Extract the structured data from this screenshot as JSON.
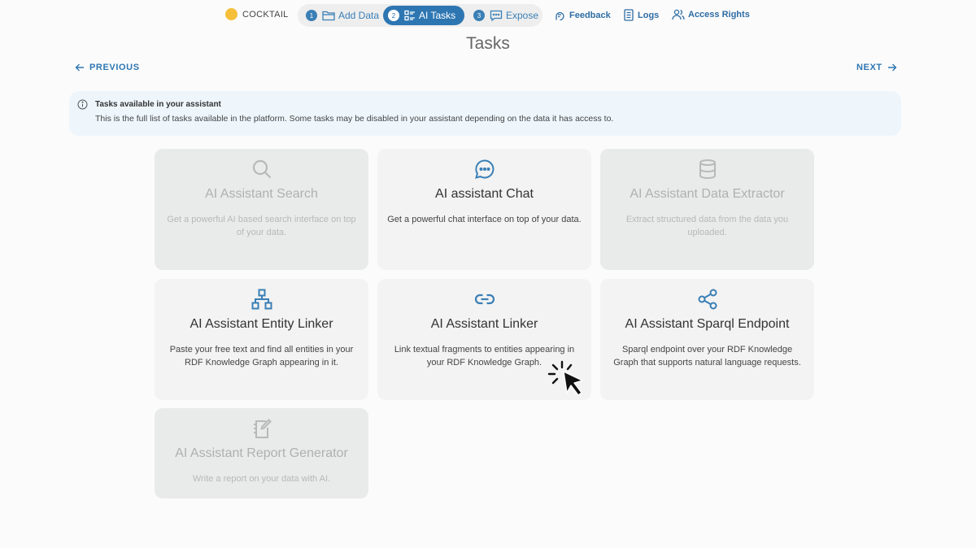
{
  "header": {
    "project_name": "COCKTAIL",
    "project_color": "#f5bf3a",
    "steps": [
      {
        "num": "1",
        "label": "Add Data",
        "icon": "folder-icon"
      },
      {
        "num": "2",
        "label": "AI Tasks",
        "icon": "checklist-icon",
        "active": true
      },
      {
        "num": "3",
        "label": "Expose",
        "icon": "chat-bubble-icon"
      }
    ],
    "links": {
      "feedback": "Feedback",
      "logs": "Logs",
      "access": "Access Rights"
    }
  },
  "page": {
    "title": "Tasks",
    "previous_label": "PREVIOUS",
    "next_label": "NEXT"
  },
  "info": {
    "title": "Tasks available in your assistant",
    "text": "This is the full list of tasks available in the platform. Some tasks may be disabled in your assistant depending on the data it has access to."
  },
  "tasks": [
    {
      "title": "AI Assistant Search",
      "desc": "Get a powerful AI based search interface on top of your data.",
      "icon": "search-icon",
      "disabled": true
    },
    {
      "title": "AI assistant Chat",
      "desc": "Get a powerful chat interface on top of your data.",
      "icon": "chat-icon",
      "disabled": false
    },
    {
      "title": "AI Assistant Data Extractor",
      "desc": "Extract structured data from the data you uploaded.",
      "icon": "database-icon",
      "disabled": true
    },
    {
      "title": "AI Assistant Entity Linker",
      "desc": "Paste your free text and find all entities in your RDF Knowledge Graph appearing in it.",
      "icon": "hierarchy-icon",
      "disabled": false
    },
    {
      "title": "AI Assistant Linker",
      "desc": "Link textual fragments to entities appearing in your RDF Knowledge Graph.",
      "icon": "link-icon",
      "disabled": false
    },
    {
      "title": "AI Assistant Sparql Endpoint",
      "desc": "Sparql endpoint over your RDF Knowledge Graph that supports natural language requests.",
      "icon": "share-icon",
      "disabled": false
    },
    {
      "title": "AI Assistant Report Generator",
      "desc": "Write a report on your data with AI.",
      "icon": "notebook-edit-icon",
      "disabled": true
    }
  ],
  "colors": {
    "accent": "#2e76b2",
    "icon_active": "#3a7fb5",
    "icon_disabled": "#b9b9b9"
  }
}
